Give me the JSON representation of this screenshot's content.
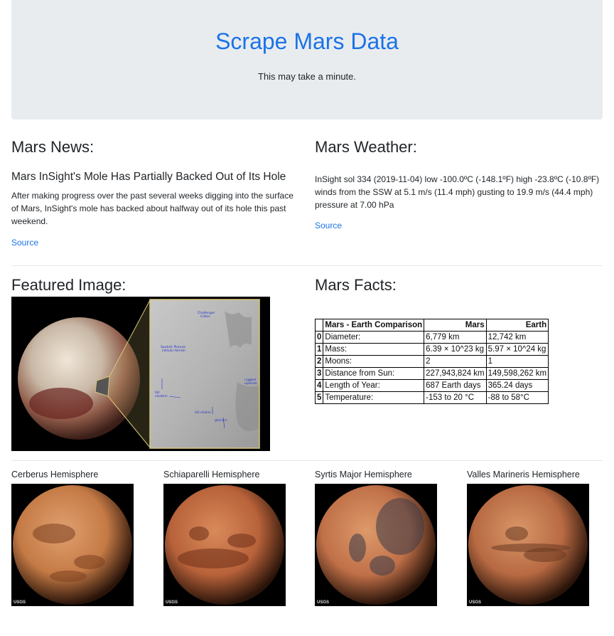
{
  "header": {
    "title": "Scrape Mars Data",
    "subtitle": "This may take a minute."
  },
  "news": {
    "heading": "Mars News:",
    "title": "Mars InSight's Mole Has Partially Backed Out of Its Hole",
    "body": "After making progress over the past several weeks digging into the surface of Mars, InSight's mole has backed about halfway out of its hole this past weekend.",
    "source_label": "Source"
  },
  "weather": {
    "heading": "Mars Weather:",
    "text": "InSight sol 334 (2019-11-04) low -100.0ºC (-148.1ºF) high -23.8ºC (-10.8ºF) winds from the SSW at 5.1 m/s (11.4 mph) gusting to 19.9 m/s (44.4 mph) pressure at 7.00 hPa",
    "source_label": "Source"
  },
  "featured": {
    "heading": "Featured Image:",
    "annotations": [
      "Challenger Colles",
      "Sputnik Planum cellular terrain",
      "hill clusters",
      "hill chains",
      "rugged uplands",
      "glaciers"
    ]
  },
  "facts": {
    "heading": "Mars Facts:",
    "columns": [
      "",
      "Mars - Earth Comparison",
      "Mars",
      "Earth"
    ],
    "rows": [
      [
        "0",
        "Diameter:",
        "6,779 km",
        "12,742 km"
      ],
      [
        "1",
        "Mass:",
        "6.39 × 10^23 kg",
        "5.97 × 10^24 kg"
      ],
      [
        "2",
        "Moons:",
        "2",
        "1"
      ],
      [
        "3",
        "Distance from Sun:",
        "227,943,824 km",
        "149,598,262 km"
      ],
      [
        "4",
        "Length of Year:",
        "687 Earth days",
        "365.24 days"
      ],
      [
        "5",
        "Temperature:",
        "-153 to 20 °C",
        "-88 to 58°C"
      ]
    ]
  },
  "hemispheres": [
    {
      "title": "Cerberus Hemisphere",
      "base": "#c47a45",
      "dark": "#7a3f1f",
      "light": "#e0a070"
    },
    {
      "title": "Schiaparelli Hemisphere",
      "base": "#b8623a",
      "dark": "#6e2f18",
      "light": "#d88a5a"
    },
    {
      "title": "Syrtis Major Hemisphere",
      "base": "#c07048",
      "dark": "#3a3a48",
      "light": "#dd9a6a"
    },
    {
      "title": "Valles Marineris Hemisphere",
      "base": "#b86a42",
      "dark": "#6a3a22",
      "light": "#d89668"
    }
  ],
  "usgs_label": "USGS"
}
